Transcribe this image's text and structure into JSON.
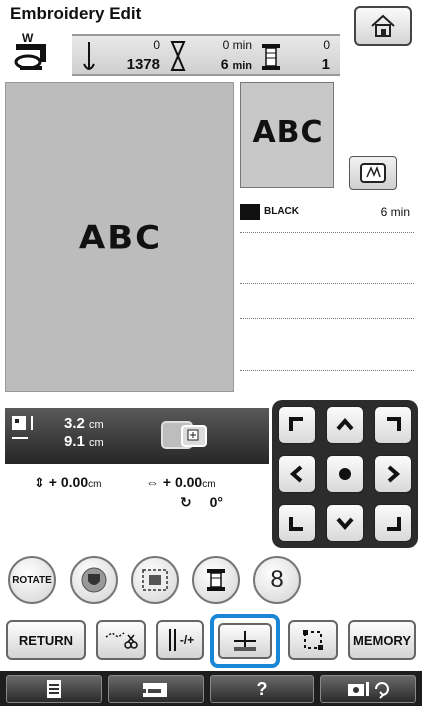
{
  "header": {
    "title": "Embroidery Edit",
    "machine_icon": "embroidery-machine-icon",
    "home_icon": "home-icon"
  },
  "stats": {
    "stitch_current": "0",
    "stitch_total": "1378",
    "time_current_value": "0",
    "time_current_unit": "min",
    "time_total_value": "6",
    "time_total_unit": "min",
    "color_current": "0",
    "color_total": "1"
  },
  "preview": {
    "text": "ABC",
    "thumb_text": "ABC"
  },
  "thread": {
    "color_name": "BLACK",
    "time": "6 min",
    "swatch": "#111111"
  },
  "size": {
    "height_value": "3.2",
    "height_unit": "cm",
    "width_value": "9.1",
    "width_unit": "cm"
  },
  "position": {
    "vertical_prefix": "+",
    "vertical_value": "0.00",
    "vertical_unit": "cm",
    "horizontal_prefix": "+",
    "horizontal_value": "0.00",
    "horizontal_unit": "cm",
    "rotation_value": "0°"
  },
  "buttons": {
    "rotate": "ROTATE",
    "density_digit": "8",
    "return": "RETURN",
    "memory": "MEMORY",
    "thread_plus_minus": "-/+"
  },
  "colors": {
    "highlight": "#1a86d6",
    "panel_dark": "#2a2a2a"
  }
}
